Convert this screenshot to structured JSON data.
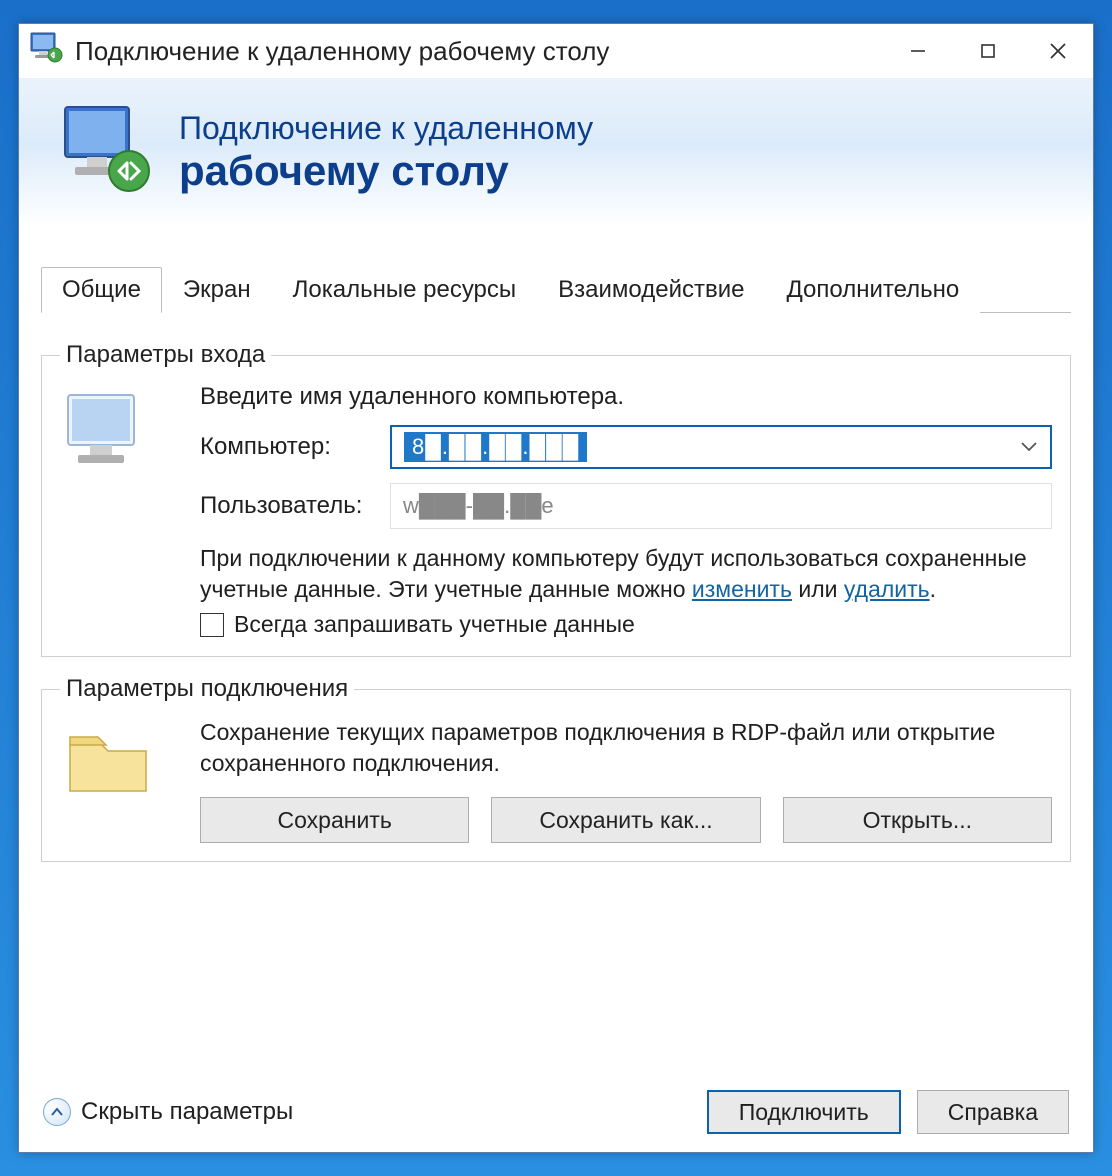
{
  "titlebar": {
    "title": "Подключение к удаленному рабочему столу"
  },
  "banner": {
    "line1": "Подключение к удаленному",
    "line2": "рабочему столу"
  },
  "tabs": [
    {
      "label": "Общие",
      "active": true
    },
    {
      "label": "Экран",
      "active": false
    },
    {
      "label": "Локальные ресурсы",
      "active": false
    },
    {
      "label": "Взаимодействие",
      "active": false
    },
    {
      "label": "Дополнительно",
      "active": false
    }
  ],
  "login_group": {
    "legend": "Параметры входа",
    "instruction": "Введите имя удаленного компьютера.",
    "computer_label": "Компьютер:",
    "computer_value": "8█.██.██.███",
    "user_label": "Пользователь:",
    "user_value": "w███-██.██e",
    "note_before": "При подключении к данному компьютеру будут использоваться сохраненные учетные данные.  Эти учетные данные можно ",
    "link_edit": "изменить",
    "note_or": " или ",
    "link_delete": "удалить",
    "note_end": ".",
    "checkbox_label": "Всегда запрашивать учетные данные",
    "checkbox_checked": false
  },
  "conn_group": {
    "legend": "Параметры подключения",
    "desc": "Сохранение текущих параметров подключения в RDP-файл или открытие сохраненного подключения.",
    "btn_save": "Сохранить",
    "btn_saveas": "Сохранить как...",
    "btn_open": "Открыть..."
  },
  "footer": {
    "toggle": "Скрыть параметры",
    "connect": "Подключить",
    "help": "Справка"
  }
}
